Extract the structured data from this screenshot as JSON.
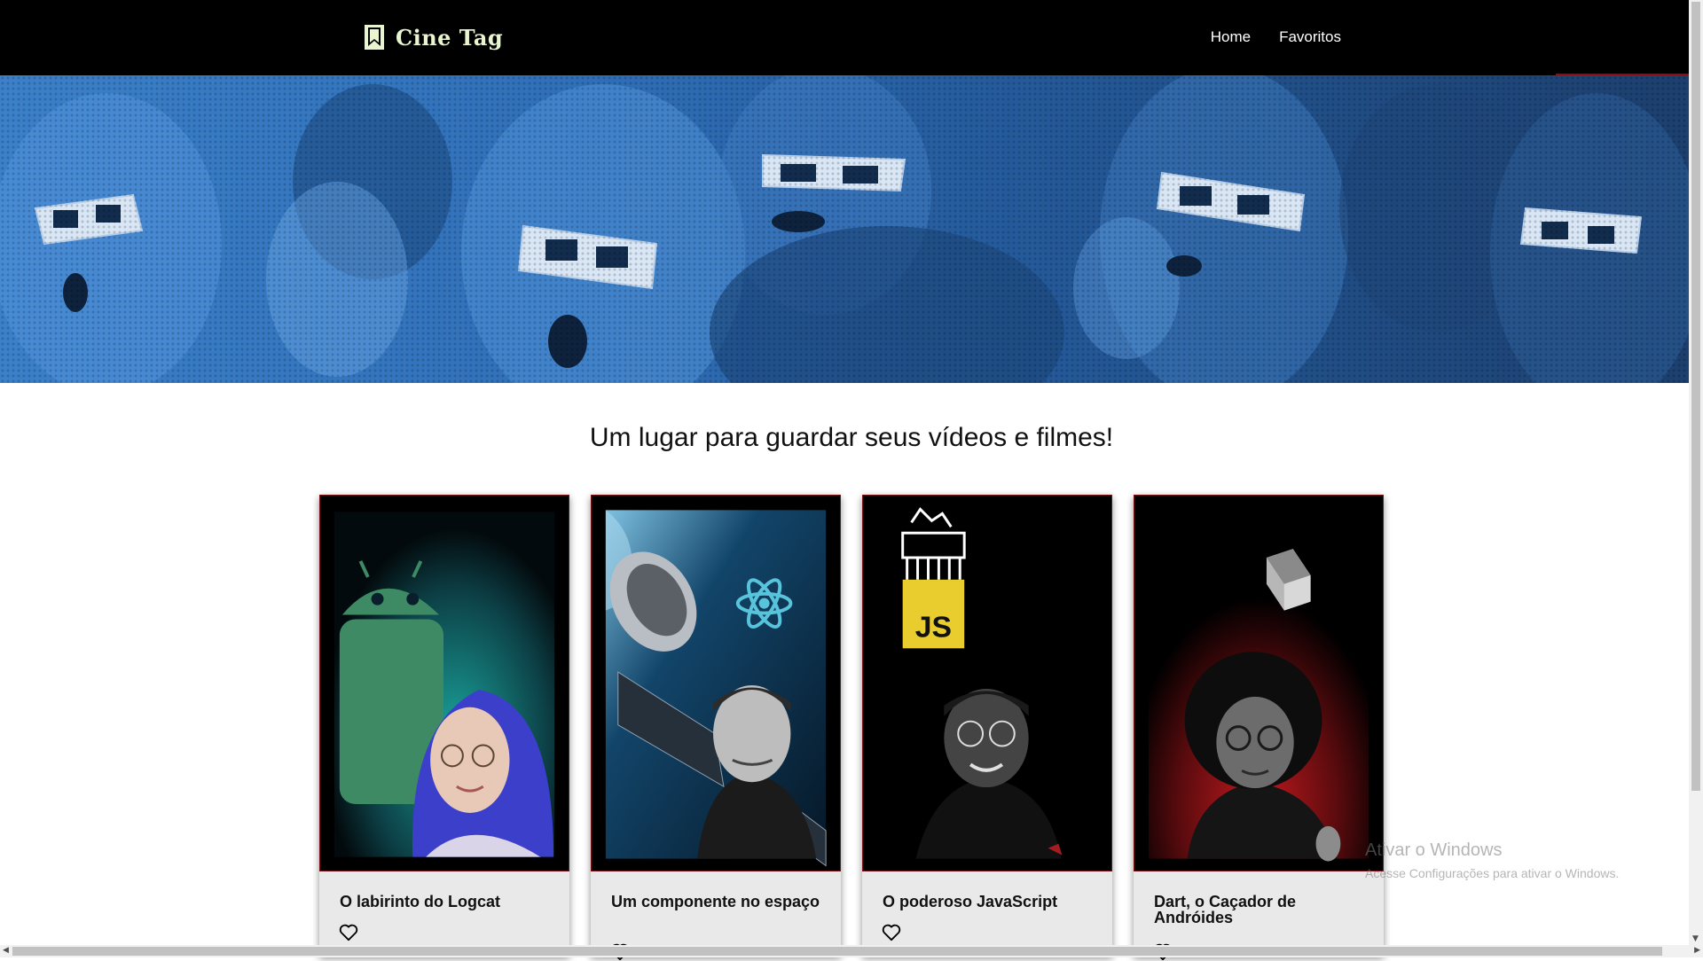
{
  "header": {
    "logo_text": "Cine Tag",
    "logo_icon": "bookmark-icon",
    "nav": [
      {
        "label": "Home"
      },
      {
        "label": "Favoritos"
      }
    ]
  },
  "banner": {
    "image": "audience-3d-glasses-banner",
    "tint_color": "#2f6fb8"
  },
  "main": {
    "headline": "Um lugar para guardar seus vídeos e filmes!",
    "cards": [
      {
        "title": "O labirinto do Logcat",
        "poster": "android-logcat-poster",
        "favorite": false
      },
      {
        "title": "Um componente no espaço",
        "poster": "react-space-poster",
        "favorite": false
      },
      {
        "title": "O poderoso JavaScript",
        "poster": "javascript-poster",
        "favorite": false
      },
      {
        "title": "Dart, o Caçador de Andróides",
        "poster": "dart-poster",
        "favorite": false
      }
    ]
  },
  "watermark": {
    "line1": "Ativar o Windows",
    "line2": "Acesse Configurações para ativar o Windows."
  },
  "colors": {
    "header_bg": "#000000",
    "logo_color": "#e9f5d0",
    "card_bg": "#e9e9e9",
    "accent_red": "#8a0d12"
  }
}
